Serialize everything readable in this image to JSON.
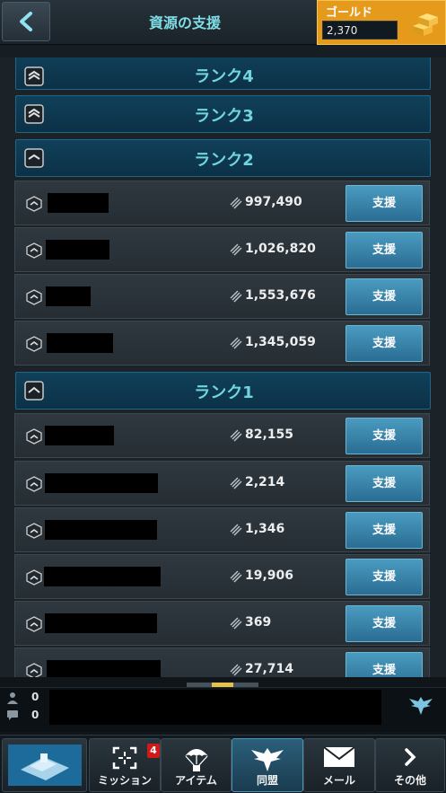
{
  "header": {
    "title": "資源の支援"
  },
  "gold": {
    "label": "ゴールド",
    "value": "2,370"
  },
  "ranks": [
    {
      "title": "ランク4"
    },
    {
      "title": "ランク3"
    },
    {
      "title": "ランク2"
    },
    {
      "title": "ランク1"
    }
  ],
  "rank2_members": [
    {
      "value": "997,490"
    },
    {
      "value": "1,026,820"
    },
    {
      "value": "1,553,676"
    },
    {
      "value": "1,345,059"
    }
  ],
  "rank1_members": [
    {
      "value": "82,155"
    },
    {
      "value": "2,214"
    },
    {
      "value": "1,346"
    },
    {
      "value": "19,906"
    },
    {
      "value": "369"
    },
    {
      "value": "27,714"
    }
  ],
  "support_label": "支援",
  "chat": {
    "player_count": "0",
    "message_count": "0"
  },
  "nav": {
    "mission_badge": "4",
    "items": [
      {
        "label": ""
      },
      {
        "label": "ミッション"
      },
      {
        "label": "アイテム"
      },
      {
        "label": "同盟"
      },
      {
        "label": "メール"
      },
      {
        "label": "その他"
      }
    ]
  },
  "icons": {
    "back": "chevron-left-icon",
    "gold": "gold-bars-icon",
    "rank": "rank-chevron-icon",
    "resource": "resource-stripes-icon",
    "alliance": "alliance-eagle-icon",
    "mission": "crosshair-icon",
    "item": "parachute-icon",
    "mail": "envelope-icon",
    "more": "chevron-right-icon"
  },
  "colors": {
    "accent": "#6fd5e0",
    "gold_bg": "#e59a1c",
    "button": "#2f7aa1"
  }
}
